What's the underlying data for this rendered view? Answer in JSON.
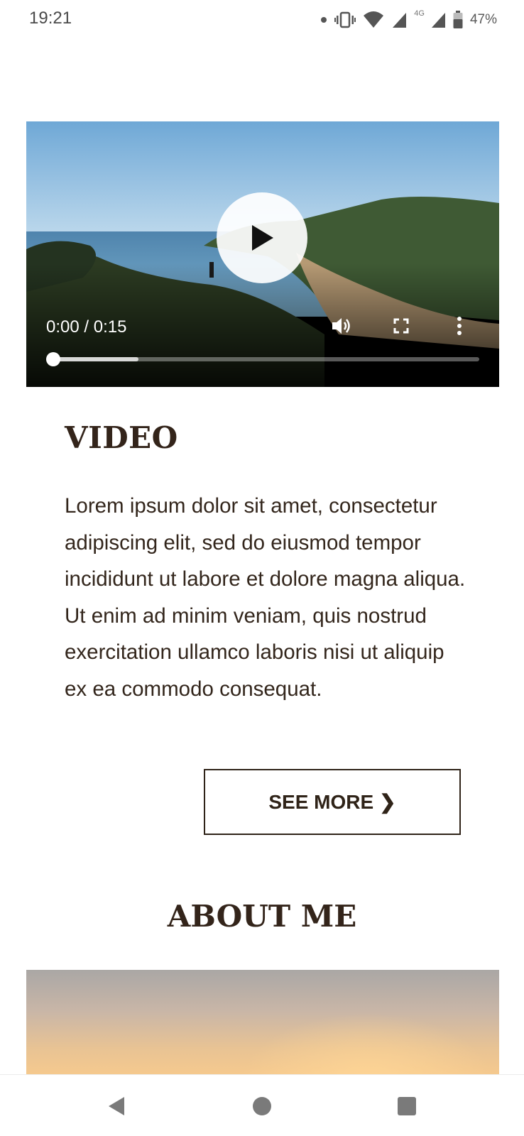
{
  "status_bar": {
    "time": "19:21",
    "network_label": "4G",
    "battery_percent": "47%",
    "icons": [
      "notification-dot-icon",
      "vibrate-icon",
      "wifi-icon",
      "signal-icon",
      "signal-icon",
      "battery-icon"
    ]
  },
  "video": {
    "time_display": "0:00 / 0:15",
    "progress_fraction": 0.0,
    "buffered_fraction": 0.2,
    "controls": [
      "play-icon",
      "volume-icon",
      "fullscreen-icon",
      "more-vert-icon"
    ]
  },
  "video_section": {
    "title": "VIDEO",
    "body": "Lorem ipsum dolor sit amet, consectetur adipiscing elit, sed do eiusmod tempor incididunt ut labore et dolore magna aliqua. Ut enim ad minim veniam, quis nostrud exercitation ullamco laboris nisi ut aliquip ex ea commodo consequat.",
    "button_label": "SEE MORE",
    "button_chevron": "❯"
  },
  "about_section": {
    "title": "ABOUT ME"
  },
  "nav_bar": {
    "icons": [
      "back-icon",
      "home-icon",
      "recents-icon"
    ]
  },
  "colors": {
    "text_dark": "#2f2318",
    "background": "#ffffff"
  }
}
